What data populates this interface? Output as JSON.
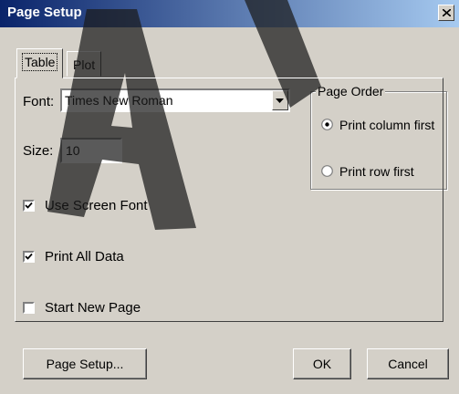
{
  "window": {
    "title": "Page Setup"
  },
  "tabs": [
    {
      "label": "Table"
    },
    {
      "label": "Plot"
    }
  ],
  "font": {
    "label": "Font:",
    "value": "Times New Roman"
  },
  "size": {
    "label": "Size:",
    "value": "10"
  },
  "checkboxes": [
    {
      "label": "Use Screen Font",
      "checked": true
    },
    {
      "label": "Print All Data",
      "checked": true
    },
    {
      "label": "Start New Page",
      "checked": false
    }
  ],
  "page_order": {
    "legend": "Page Order",
    "options": [
      {
        "label": "Print column first",
        "selected": true
      },
      {
        "label": "Print row first",
        "selected": false
      }
    ]
  },
  "buttons": {
    "page_setup": "Page Setup...",
    "ok": "OK",
    "cancel": "Cancel"
  },
  "watermark": {
    "text": "AI"
  },
  "colors": {
    "dialog_bg": "#d4d0c8",
    "title_start": "#0a246a",
    "title_end": "#a6caf0"
  }
}
